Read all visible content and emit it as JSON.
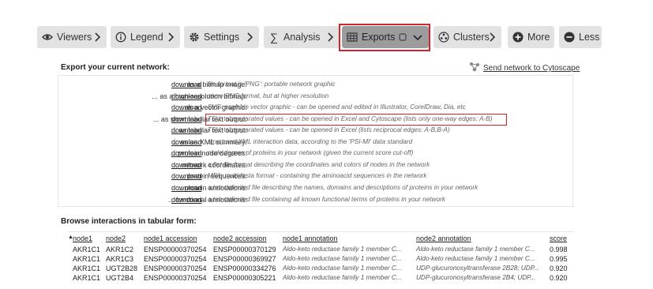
{
  "toolbar": {
    "viewers": "Viewers",
    "legend": "Legend",
    "settings": "Settings",
    "analysis": "Analysis",
    "exports": "Exports",
    "clusters": "Clusters",
    "more": "More",
    "less": "Less"
  },
  "export_section": {
    "title": "Export your current network:",
    "send_link": "Send network to Cytoscape",
    "download_label": "download",
    "rows": [
      {
        "label": "... as a bitmap image:",
        "desc": "file format is 'PNG': portable network graphic"
      },
      {
        "label": "... as a high-resolution bitmap:",
        "desc": "same PNG format, but at higher resolution"
      },
      {
        "label": "... as a vector graphic:",
        "desc": "SVG: scalable vector graphic - can be opened and edited in Illustrator, CorelDraw, Dia, etc"
      },
      {
        "label": "... as short tabular text output:",
        "desc": "TSV: tab separated values - can be opened in Excel and Cytoscape (lists only one-way edges: A-B)"
      },
      {
        "label": "... as tabular text output:",
        "desc": "TSV: tab separated values - can be opened in Excel (lists reciprocal edges: A-B,B-A)"
      },
      {
        "label": "... as an XML summary:",
        "desc": "structured XML interaction data, according to the 'PSI-MI' data standard"
      },
      {
        "label": "... protein node degrees:",
        "desc": "node degree of proteins in your network (given the current score cut-off)"
      },
      {
        "label": "... network coordinates:",
        "desc": "a flat-file format describing the coordinates and colors of nodes in the network"
      },
      {
        "label": "... protein sequences:",
        "desc": "MFA: multi-fasta format - containing the aminoacid sequences in the network"
      },
      {
        "label": "... protein annotations:",
        "desc": "a tab-delimited file describing the names, domains and descriptions of proteins in your network"
      },
      {
        "label": "... functional annotations:",
        "desc": "a tab-delimited file containing all known functional terms of proteins in your network"
      }
    ]
  },
  "table_section": {
    "title": "Browse interactions in tabular form:",
    "headers": [
      "node1",
      "node2",
      "node1 accession",
      "node2 accession",
      "node1 annotation",
      "node2 annotation",
      "score"
    ],
    "sort_marker": "▲",
    "rows": [
      [
        "AKR1C1",
        "AKR1C2",
        "ENSP00000370254",
        "ENSP00000370129",
        "Aldo-keto reductase family 1 member C...",
        "Aldo-keto reductase family 1 member C...",
        "0.998"
      ],
      [
        "AKR1C1",
        "AKR1C3",
        "ENSP00000370254",
        "ENSP00000369927",
        "Aldo-keto reductase family 1 member C...",
        "Aldo-keto reductase family 1 member C...",
        "0.995"
      ],
      [
        "AKR1C1",
        "UGT2B28",
        "ENSP00000370254",
        "ENSP00000334276",
        "Aldo-keto reductase family 1 member C...",
        "UDP-glucuronosyltransferase 2B28; UDP...",
        "0.920"
      ],
      [
        "AKR1C1",
        "UGT2B4",
        "ENSP00000370254",
        "ENSP00000305221",
        "Aldo-keto reductase family 1 member C...",
        "UDP-glucuronosyltransferase 2B4; UDP...",
        "0.920"
      ]
    ]
  },
  "colors": {
    "highlight": "#d2232a",
    "active_button": "#9c9c9c",
    "button": "#e2e2e2"
  }
}
